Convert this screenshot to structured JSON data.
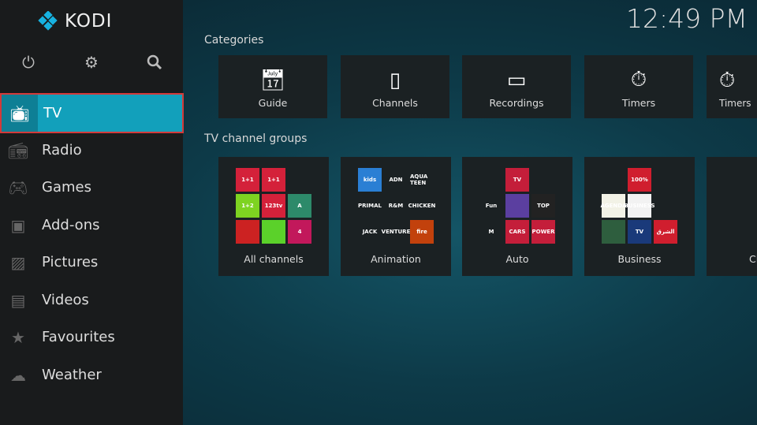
{
  "app": {
    "name": "KODI",
    "clock": "12:49 PM"
  },
  "top_icons": [
    "power-icon",
    "gear-icon",
    "search-icon"
  ],
  "sidebar": {
    "items": [
      {
        "label": "TV",
        "icon": "tv-icon",
        "active": true
      },
      {
        "label": "Radio",
        "icon": "radio-icon"
      },
      {
        "label": "Games",
        "icon": "gamepad-icon"
      },
      {
        "label": "Add-ons",
        "icon": "box-icon"
      },
      {
        "label": "Pictures",
        "icon": "picture-icon"
      },
      {
        "label": "Videos",
        "icon": "film-icon"
      },
      {
        "label": "Favourites",
        "icon": "star-icon"
      },
      {
        "label": "Weather",
        "icon": "weather-icon"
      }
    ]
  },
  "main": {
    "categories_title": "Categories",
    "categories": [
      {
        "label": "Guide",
        "icon": "calendar-icon"
      },
      {
        "label": "Channels",
        "icon": "remote-icon"
      },
      {
        "label": "Recordings",
        "icon": "cassette-icon"
      },
      {
        "label": "Timers",
        "icon": "stopwatch-icon"
      },
      {
        "label": "Timers",
        "icon": "stopwatch-icon"
      }
    ],
    "groups_title": "TV channel groups",
    "groups": [
      {
        "label": "All channels",
        "logos": [
          "1+1",
          "1+1",
          "",
          "1+2",
          "123tv",
          "A",
          "",
          "",
          "4"
        ],
        "colors": [
          "#d4213a",
          "#d4213a",
          "transparent",
          "#7ed321",
          "#d4213a",
          "#2d8a6a",
          "#c22",
          "#5bd12a",
          "#c2185b"
        ]
      },
      {
        "label": "Animation",
        "logos": [
          "kids",
          "ADN",
          "AQUA TEEN",
          "PRIMAL",
          "R&M",
          "CHICKEN",
          "JACK",
          "VENTURE",
          "fire"
        ],
        "colors": [
          "#2a7fd4",
          "transparent",
          "transparent",
          "transparent",
          "transparent",
          "transparent",
          "transparent",
          "transparent",
          "#c2410c"
        ]
      },
      {
        "label": "Auto",
        "logos": [
          "",
          "TV",
          "",
          "Fun",
          "",
          "TOP",
          "M",
          "CARS",
          "POWER"
        ],
        "colors": [
          "transparent",
          "#c41e3a",
          "transparent",
          "transparent",
          "#5b3fa0",
          "#222",
          "transparent",
          "#c41e3a",
          "#c41e3a"
        ]
      },
      {
        "label": "Business",
        "logos": [
          "",
          "100%",
          "",
          "AGENDA",
          "BUSINESS",
          "",
          "",
          "TV",
          "الشرق"
        ],
        "colors": [
          "transparent",
          "#d01e2e",
          "transparent",
          "#f2f2e6",
          "#f2f2f2",
          "transparent",
          "#2e5e3e",
          "#1a3a7a",
          "#d01e2e"
        ]
      },
      {
        "label": "Cl",
        "logos": [],
        "colors": []
      }
    ]
  }
}
